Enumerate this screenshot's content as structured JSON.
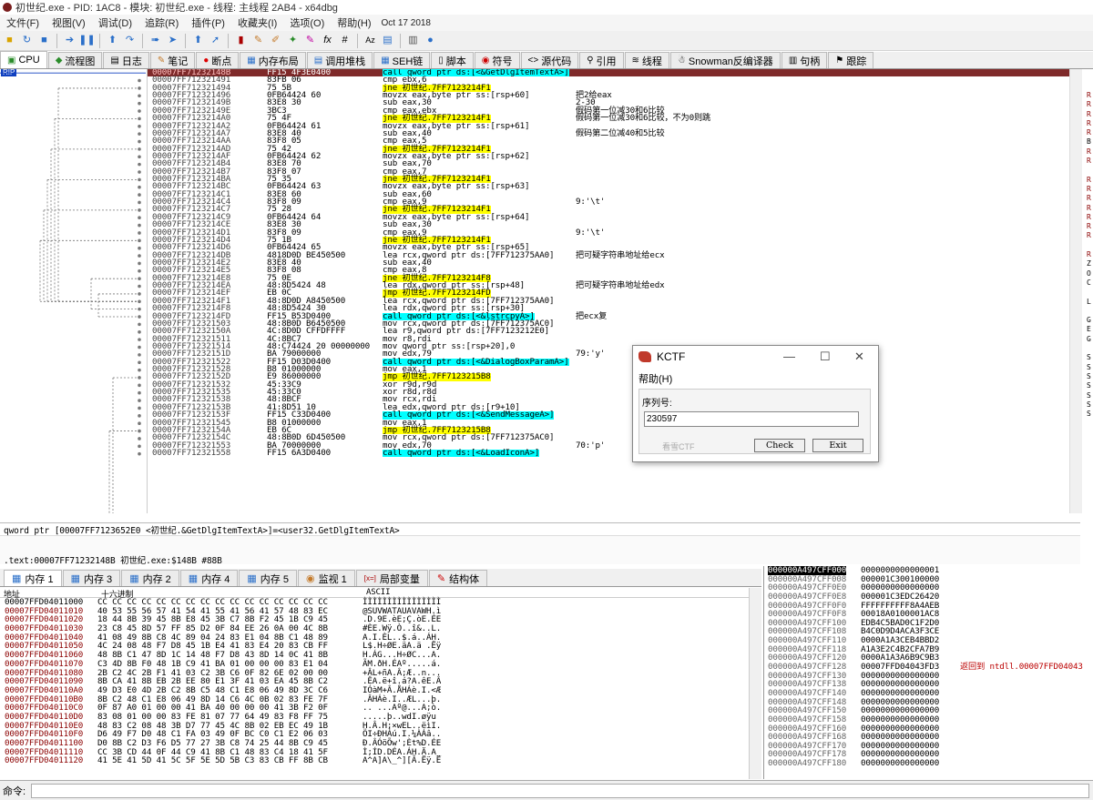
{
  "window": {
    "title": "初世纪.exe - PID: 1AC8 - 模块: 初世纪.exe - 线程: 主线程 2AB4 - x64dbg"
  },
  "menu": {
    "items": [
      "文件(F)",
      "视图(V)",
      "调试(D)",
      "追踪(R)",
      "插件(P)",
      "收藏夹(I)",
      "选项(O)",
      "帮助(H)"
    ],
    "date": "Oct 17 2018"
  },
  "tabs": [
    {
      "label": "CPU",
      "icon": "cpu-icon"
    },
    {
      "label": "流程图",
      "icon": "graph-icon"
    },
    {
      "label": "日志",
      "icon": "log-icon"
    },
    {
      "label": "笔记",
      "icon": "notes-icon"
    },
    {
      "label": "断点",
      "icon": "breakpoint-icon"
    },
    {
      "label": "内存布局",
      "icon": "memory-map-icon"
    },
    {
      "label": "调用堆栈",
      "icon": "call-stack-icon"
    },
    {
      "label": "SEH链",
      "icon": "seh-icon"
    },
    {
      "label": "脚本",
      "icon": "script-icon"
    },
    {
      "label": "符号",
      "icon": "symbols-icon"
    },
    {
      "label": "源代码",
      "icon": "source-icon"
    },
    {
      "label": "引用",
      "icon": "references-icon"
    },
    {
      "label": "线程",
      "icon": "threads-icon"
    },
    {
      "label": "Snowman反编译器",
      "icon": "snowman-icon"
    },
    {
      "label": "句柄",
      "icon": "handles-icon"
    },
    {
      "label": "跟踪",
      "icon": "trace-icon"
    }
  ],
  "rip_label": "RIP",
  "disasm": [
    {
      "addr": "00007FF71232148B",
      "bytes": "FF15 4F3E0400",
      "instr": "call qword ptr ds:[<&GetDlgItemTextA>]",
      "kind": "call",
      "comment": ""
    },
    {
      "addr": "00007FF712321491",
      "bytes": "83FB 06",
      "instr": "cmp ebx,6",
      "kind": "",
      "comment": ""
    },
    {
      "addr": "00007FF712321494",
      "bytes": "75 5B",
      "instr": "jne 初世纪.7FF7123214F1",
      "kind": "jmp",
      "comment": ""
    },
    {
      "addr": "00007FF712321496",
      "bytes": "0FB64424 60",
      "instr": "movzx eax,byte ptr ss:[rsp+60]",
      "kind": "",
      "comment": "把2给eax"
    },
    {
      "addr": "00007FF71232149B",
      "bytes": "83E8 30",
      "instr": "sub eax,30",
      "kind": "",
      "comment": "2-30"
    },
    {
      "addr": "00007FF71232149E",
      "bytes": "3BC3",
      "instr": "cmp eax,ebx",
      "kind": "",
      "comment": "假码第一位减30和6比较"
    },
    {
      "addr": "00007FF7123214A0",
      "bytes": "75 4F",
      "instr": "jne 初世纪.7FF7123214F1",
      "kind": "jmp",
      "comment": "假码第一位减30和6比较，不为0则跳"
    },
    {
      "addr": "00007FF7123214A2",
      "bytes": "0FB64424 61",
      "instr": "movzx eax,byte ptr ss:[rsp+61]",
      "kind": "",
      "comment": ""
    },
    {
      "addr": "00007FF7123214A7",
      "bytes": "83E8 40",
      "instr": "sub eax,40",
      "kind": "",
      "comment": "假码第二位减40和5比较"
    },
    {
      "addr": "00007FF7123214AA",
      "bytes": "83F8 05",
      "instr": "cmp eax,5",
      "kind": "",
      "comment": ""
    },
    {
      "addr": "00007FF7123214AD",
      "bytes": "75 42",
      "instr": "jne 初世纪.7FF7123214F1",
      "kind": "jmp",
      "comment": ""
    },
    {
      "addr": "00007FF7123214AF",
      "bytes": "0FB64424 62",
      "instr": "movzx eax,byte ptr ss:[rsp+62]",
      "kind": "",
      "comment": ""
    },
    {
      "addr": "00007FF7123214B4",
      "bytes": "83E8 70",
      "instr": "sub eax,70",
      "kind": "",
      "comment": ""
    },
    {
      "addr": "00007FF7123214B7",
      "bytes": "83F8 07",
      "instr": "cmp eax,7",
      "kind": "",
      "comment": ""
    },
    {
      "addr": "00007FF7123214BA",
      "bytes": "75 35",
      "instr": "jne 初世纪.7FF7123214F1",
      "kind": "jmp",
      "comment": ""
    },
    {
      "addr": "00007FF7123214BC",
      "bytes": "0FB64424 63",
      "instr": "movzx eax,byte ptr ss:[rsp+63]",
      "kind": "",
      "comment": ""
    },
    {
      "addr": "00007FF7123214C1",
      "bytes": "83E8 60",
      "instr": "sub eax,60",
      "kind": "",
      "comment": ""
    },
    {
      "addr": "00007FF7123214C4",
      "bytes": "83F8 09",
      "instr": "cmp eax,9",
      "kind": "",
      "comment": "9:'\\t'"
    },
    {
      "addr": "00007FF7123214C7",
      "bytes": "75 28",
      "instr": "jne 初世纪.7FF7123214F1",
      "kind": "jmp",
      "comment": ""
    },
    {
      "addr": "00007FF7123214C9",
      "bytes": "0FB64424 64",
      "instr": "movzx eax,byte ptr ss:[rsp+64]",
      "kind": "",
      "comment": ""
    },
    {
      "addr": "00007FF7123214CE",
      "bytes": "83E8 30",
      "instr": "sub eax,30",
      "kind": "",
      "comment": ""
    },
    {
      "addr": "00007FF7123214D1",
      "bytes": "83F8 09",
      "instr": "cmp eax,9",
      "kind": "",
      "comment": "9:'\\t'"
    },
    {
      "addr": "00007FF7123214D4",
      "bytes": "75 1B",
      "instr": "jne 初世纪.7FF7123214F1",
      "kind": "jmp",
      "comment": ""
    },
    {
      "addr": "00007FF7123214D6",
      "bytes": "0FB64424 65",
      "instr": "movzx eax,byte ptr ss:[rsp+65]",
      "kind": "",
      "comment": ""
    },
    {
      "addr": "00007FF7123214DB",
      "bytes": "4818D0D BE450500",
      "instr": "lea rcx,qword ptr ds:[7FF712375AA0]",
      "kind": "",
      "comment": "把可疑字符串地址给ecx"
    },
    {
      "addr": "00007FF7123214E2",
      "bytes": "83E8 40",
      "instr": "sub eax,40",
      "kind": "",
      "comment": ""
    },
    {
      "addr": "00007FF7123214E5",
      "bytes": "83F8 08",
      "instr": "cmp eax,8",
      "kind": "",
      "comment": ""
    },
    {
      "addr": "00007FF7123214E8",
      "bytes": "75 0E",
      "instr": "jne 初世纪.7FF7123214F8",
      "kind": "jmp",
      "comment": ""
    },
    {
      "addr": "00007FF7123214EA",
      "bytes": "48:8D5424 48",
      "instr": "lea rdx,qword ptr ss:[rsp+48]",
      "kind": "",
      "comment": "把可疑字符串地址给edx"
    },
    {
      "addr": "00007FF7123214EF",
      "bytes": "EB 0C",
      "instr": "jmp 初世纪.7FF7123214FD",
      "kind": "jmp",
      "comment": ""
    },
    {
      "addr": "00007FF7123214F1",
      "bytes": "48:8D0D A8450500",
      "instr": "lea rcx,qword ptr ds:[7FF712375AA0]",
      "kind": "",
      "comment": ""
    },
    {
      "addr": "00007FF7123214F8",
      "bytes": "48:8D5424 30",
      "instr": "lea rdx,qword ptr ss:[rsp+30]",
      "kind": "",
      "comment": ""
    },
    {
      "addr": "00007FF7123214FD",
      "bytes": "FF15 B53D0400",
      "instr": "call qword ptr ds:[<&lstrcpyA>]",
      "kind": "call",
      "comment": "把ecx复"
    },
    {
      "addr": "00007FF712321503",
      "bytes": "48:8B0D B6450500",
      "instr": "mov rcx,qword ptr ds:[7FF712375AC0]",
      "kind": "",
      "comment": ""
    },
    {
      "addr": "00007FF71232150A",
      "bytes": "4C:8D0D CFFDFFFF",
      "instr": "lea r9,qword ptr ds:[7FF7123212E0]",
      "kind": "",
      "comment": ""
    },
    {
      "addr": "00007FF712321511",
      "bytes": "4C:8BC7",
      "instr": "mov r8,rdi",
      "kind": "",
      "comment": ""
    },
    {
      "addr": "00007FF712321514",
      "bytes": "48:C74424 20 00000000",
      "instr": "mov qword ptr ss:[rsp+20],0",
      "kind": "",
      "comment": ""
    },
    {
      "addr": "00007FF71232151D",
      "bytes": "BA 79000000",
      "instr": "mov edx,79",
      "kind": "",
      "comment": "79:'y'"
    },
    {
      "addr": "00007FF712321522",
      "bytes": "FF15 D03D0400",
      "instr": "call qword ptr ds:[<&DialogBoxParamA>]",
      "kind": "call",
      "comment": ""
    },
    {
      "addr": "00007FF712321528",
      "bytes": "B8 01000000",
      "instr": "mov eax,1",
      "kind": "",
      "comment": ""
    },
    {
      "addr": "00007FF71232152D",
      "bytes": "E9 86000000",
      "instr": "jmp 初世纪.7FF7123215B8",
      "kind": "jmp",
      "comment": ""
    },
    {
      "addr": "00007FF712321532",
      "bytes": "45:33C9",
      "instr": "xor r9d,r9d",
      "kind": "",
      "comment": ""
    },
    {
      "addr": "00007FF712321535",
      "bytes": "45:33C0",
      "instr": "xor r8d,r8d",
      "kind": "",
      "comment": ""
    },
    {
      "addr": "00007FF712321538",
      "bytes": "48:8BCF",
      "instr": "mov rcx,rdi",
      "kind": "",
      "comment": ""
    },
    {
      "addr": "00007FF71232153B",
      "bytes": "41:8D51 10",
      "instr": "lea edx,qword ptr ds:[r9+10]",
      "kind": "",
      "comment": ""
    },
    {
      "addr": "00007FF71232153F",
      "bytes": "FF15 C33D0400",
      "instr": "call qword ptr ds:[<&SendMessageA>]",
      "kind": "call",
      "comment": ""
    },
    {
      "addr": "00007FF712321545",
      "bytes": "B8 01000000",
      "instr": "mov eax,1",
      "kind": "",
      "comment": ""
    },
    {
      "addr": "00007FF71232154A",
      "bytes": "EB 6C",
      "instr": "jmp 初世纪.7FF7123215B8",
      "kind": "jmp",
      "comment": ""
    },
    {
      "addr": "00007FF71232154C",
      "bytes": "48:8B0D 6D450500",
      "instr": "mov rcx,qword ptr ds:[7FF712375AC0]",
      "kind": "",
      "comment": ""
    },
    {
      "addr": "00007FF712321553",
      "bytes": "BA 70000000",
      "instr": "mov edx,70",
      "kind": "",
      "comment": "70:'p'"
    },
    {
      "addr": "00007FF712321558",
      "bytes": "FF15 6A3D0400",
      "instr": "call qword ptr ds:[<&LoadIconA>]",
      "kind": "call",
      "comment": ""
    }
  ],
  "info_line1": "qword ptr [00007FF7123652E0 <初世纪.&GetDlgItemTextA>]=<user32.GetDlgItemTextA>",
  "info_line2": ".text:00007FF71232148B 初世纪.exe:$148B #88B",
  "bottom_tabs": [
    {
      "label": "内存 1",
      "icon": "memory-icon"
    },
    {
      "label": "内存 3",
      "icon": "memory-icon"
    },
    {
      "label": "内存 2",
      "icon": "memory-icon"
    },
    {
      "label": "内存 4",
      "icon": "memory-icon"
    },
    {
      "label": "内存 5",
      "icon": "memory-icon"
    },
    {
      "label": "监视 1",
      "icon": "watch-icon"
    },
    {
      "label": "局部变量",
      "icon": "locals-icon"
    },
    {
      "label": "结构体",
      "icon": "struct-icon"
    }
  ],
  "dump_header": {
    "addr": "地址",
    "hex": "十六进制",
    "ascii": "ASCII"
  },
  "dump": [
    {
      "addr": "00007FFD04011000",
      "hex": "CC CC CC CC CC CC CC CC CC CC CC CC CC CC CC CC",
      "ascii": "ÌÌÌÌÌÌÌÌÌÌÌÌÌÌÌÌ"
    },
    {
      "addr": "00007FFD04011010",
      "hex": "40 53 55 56 57 41 54 41 55 41 56 41 57 48 83 EC",
      "ascii": "@SUVWATAUAVAWH.ì"
    },
    {
      "addr": "00007FFD04011020",
      "hex": "18 44 8B 39 45 8B E8 45 3B C7 8B F2 45 1B C9 45",
      "ascii": ".D.9E.èE;Ç.òE.ÉE"
    },
    {
      "addr": "00007FFD04011030",
      "hex": "23 C8 45 8D 57 FF 85 D2 0F 84 EE 26 0A 00 4C 8B",
      "ascii": "#ÈE.Wÿ.Ò..î&..L."
    },
    {
      "addr": "00007FFD04011040",
      "hex": "41 08 49 8B C8 4C 89 04 24 83 E1 04 8B C1 48 89",
      "ascii": "A.I.ÈL..$.á..ÁH."
    },
    {
      "addr": "00007FFD04011050",
      "hex": "4C 24 08 48 F7 D8 45 1B E4 41 83 E4 20 83 CB FF",
      "ascii": "L$.H÷ØE.äA.ä .Ëÿ"
    },
    {
      "addr": "00007FFD04011060",
      "hex": "48 8B C1 47 8D 1C 14 48 F7 D8 43 8D 14 0C 41 8B",
      "ascii": "H.ÁG...H÷ØC...A."
    },
    {
      "addr": "00007FFD04011070",
      "hex": "C3 4D 8B F0 48 1B C9 41 BA 01 00 00 00 83 E1 04",
      "ascii": "ÃM.ðH.ÉAº.....á."
    },
    {
      "addr": "00007FFD04011080",
      "hex": "2B C2 4C 2B F1 41 03 C2 3B C6 0F 82 6E 02 00 00",
      "ascii": "+ÂL+ñA.Â;Æ..n..."
    },
    {
      "addr": "00007FFD04011090",
      "hex": "8B CA 41 8B EB 2B EE 80 E1 3F 41 03 EA 45 8B C2",
      "ascii": ".ÊA.ë+î.á?A.êE.Â"
    },
    {
      "addr": "00007FFD040110A0",
      "hex": "49 D3 E0 4D 2B C2 8B C5 48 C1 E8 06 49 8D 3C C6",
      "ascii": "IÓàM+Â.ÅHÁè.I.<Æ"
    },
    {
      "addr": "00007FFD040110B0",
      "hex": "8B C2 48 C1 E8 06 49 8D 14 C6 4C 0B 02 83 FE 7F",
      "ascii": ".ÂHÁè.I..ÆL...þ."
    },
    {
      "addr": "00007FFD040110C0",
      "hex": "0F 87 A0 01 00 00 41 BA 40 00 00 00 41 3B F2 0F",
      "ascii": ".. ...Aº@...A;ò."
    },
    {
      "addr": "00007FFD040110D0",
      "hex": "83 08 01 00 00 83 FE 81 07 77 64 49 83 F8 FF 75",
      "ascii": ".....þ..wdI.øÿu"
    },
    {
      "addr": "00007FFD040110E0",
      "hex": "48 83 C2 08 48 3B D7 77 45 4C 8B 02 EB EC 49 1B",
      "ascii": "H.Â.H;×wEL..ëìI."
    },
    {
      "addr": "00007FFD040110F0",
      "hex": "D6 49 F7 D0 48 C1 FA 03 49 0F BC C0 C1 E2 06 03",
      "ascii": "ÖI÷ÐHÁú.I.¼ÀÁâ.."
    },
    {
      "addr": "00007FFD04011100",
      "hex": "D0 8B C2 D3 F6 D5 77 27 3B C8 74 25 44 8B C9 45",
      "ascii": "Ð.ÂÓöÕw';Èt%D.ÉE"
    },
    {
      "addr": "00007FFD04011110",
      "hex": "CC 3B CD 44 0F 44 C9 41 8B C1 48 83 C4 18 41 5F",
      "ascii": "Ì;ÍD.DÉA.ÁH.Ä.A_"
    },
    {
      "addr": "00007FFD04011120",
      "hex": "41 5E 41 5D 41 5C 5F 5E 5D 5B C3 83 CB FF 8B CB",
      "ascii": "A^A]A\\_^][Ã.Ëÿ.Ë"
    }
  ],
  "stack": [
    {
      "addr": "000000A497CFF000",
      "val": "0000000000000001",
      "cmt": ""
    },
    {
      "addr": "000000A497CFF008",
      "val": "000001C300100000",
      "cmt": ""
    },
    {
      "addr": "000000A497CFF0E0",
      "val": "0000000000000000",
      "cmt": ""
    },
    {
      "addr": "000000A497CFF0E8",
      "val": "000001C3EDC26420",
      "cmt": ""
    },
    {
      "addr": "000000A497CFF0F0",
      "val": "FFFFFFFFFF8A4AEB",
      "cmt": ""
    },
    {
      "addr": "000000A497CFF0F8",
      "val": "00018A0100001AC8",
      "cmt": ""
    },
    {
      "addr": "000000A497CFF100",
      "val": "EDB4C5BAD0C1F2D0",
      "cmt": ""
    },
    {
      "addr": "000000A497CFF108",
      "val": "B4C0D9D4ACA3F3CE",
      "cmt": ""
    },
    {
      "addr": "000000A497CFF110",
      "val": "0000A1A3CEB4BBD2",
      "cmt": ""
    },
    {
      "addr": "000000A497CFF118",
      "val": "A1A3E2C4B2CFA7B9",
      "cmt": ""
    },
    {
      "addr": "000000A497CFF120",
      "val": "0000A1A3A6B9C9B3",
      "cmt": ""
    },
    {
      "addr": "000000A497CFF128",
      "val": "00007FFD04043FD3",
      "cmt": "返回到 ntdll.00007FFD04043"
    },
    {
      "addr": "000000A497CFF130",
      "val": "0000000000000000",
      "cmt": ""
    },
    {
      "addr": "000000A497CFF138",
      "val": "0000000000000000",
      "cmt": ""
    },
    {
      "addr": "000000A497CFF140",
      "val": "0000000000000000",
      "cmt": ""
    },
    {
      "addr": "000000A497CFF148",
      "val": "0000000000000000",
      "cmt": ""
    },
    {
      "addr": "000000A497CFF150",
      "val": "0000000000000000",
      "cmt": ""
    },
    {
      "addr": "000000A497CFF158",
      "val": "0000000000000000",
      "cmt": ""
    },
    {
      "addr": "000000A497CFF160",
      "val": "0000000000000000",
      "cmt": ""
    },
    {
      "addr": "000000A497CFF168",
      "val": "0000000000000000",
      "cmt": ""
    },
    {
      "addr": "000000A497CFF170",
      "val": "0000000000000000",
      "cmt": ""
    },
    {
      "addr": "000000A497CFF178",
      "val": "0000000000000000",
      "cmt": ""
    },
    {
      "addr": "000000A497CFF180",
      "val": "0000000000000000",
      "cmt": ""
    }
  ],
  "cmd_label": "命令:",
  "dialog": {
    "title": "KCTF",
    "menu": "帮助(H)",
    "group_label": "序列号:",
    "serial_value": "230597",
    "link_text": "看雪CTF",
    "check_label": "Check",
    "exit_label": "Exit"
  },
  "reg_letters": [
    "R",
    "R",
    "R",
    "R",
    "R",
    "B",
    "R",
    "R",
    "",
    "R",
    "R",
    "R",
    "R",
    "R",
    "R",
    "R",
    "",
    "R",
    "Z",
    "O",
    "C",
    "",
    "L",
    "",
    "G",
    "E",
    "G",
    "",
    "S",
    "S",
    "S",
    "S",
    "S",
    "S",
    "S"
  ],
  "colors": {
    "accent_selected": "#7f2a2a",
    "call_highlight": "#00ffff",
    "jump_highlight": "#ffff00"
  }
}
